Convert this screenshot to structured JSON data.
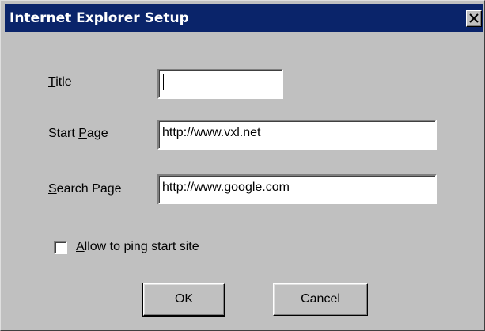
{
  "window": {
    "title": "Internet Explorer Setup",
    "close_icon": "close-icon"
  },
  "form": {
    "title": {
      "label_mnemonic": "T",
      "label_rest": "itle",
      "value": ""
    },
    "start_page": {
      "label_prefix": "Start ",
      "label_mnemonic": "P",
      "label_rest": "age",
      "value": "http://www.vxl.net"
    },
    "search_page": {
      "label_mnemonic": "S",
      "label_rest": "earch Page",
      "value": "http://www.google.com"
    },
    "ping_checkbox": {
      "label_mnemonic": "A",
      "label_rest": "llow to ping start site",
      "checked": false
    }
  },
  "buttons": {
    "ok_label": "OK",
    "cancel_label": "Cancel"
  },
  "colors": {
    "titlebar": "#0a246a",
    "face": "#c0c0c0"
  }
}
